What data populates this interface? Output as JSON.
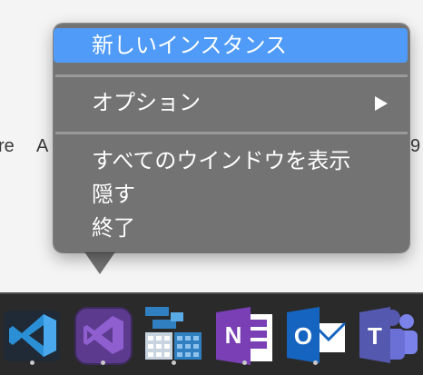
{
  "background_text": {
    "left_fragment": "re",
    "middle_fragment": "A",
    "right_fragment": "9"
  },
  "context_menu": {
    "items": [
      {
        "label": "新しいインスタンス",
        "highlighted": true
      },
      {
        "label": "オプション",
        "has_submenu": true
      },
      {
        "label": "すべてのウインドウを表示"
      },
      {
        "label": "隠す"
      },
      {
        "label": "終了"
      }
    ],
    "highlight_color": "#4f9bf7"
  },
  "dock": {
    "apps": [
      {
        "name": "visual-studio-code-icon",
        "color": "#2b8fd6",
        "running": true
      },
      {
        "name": "visual-studio-icon",
        "color": "#6b3fa0",
        "running": true
      },
      {
        "name": "azure-data-studio-icon",
        "color": "#2f7fc1",
        "running": true
      },
      {
        "name": "onenote-icon",
        "color": "#7a3fb5",
        "running": true
      },
      {
        "name": "outlook-icon",
        "color": "#1565c0",
        "running": true
      },
      {
        "name": "teams-icon",
        "color": "#5558af",
        "running": false
      }
    ]
  }
}
